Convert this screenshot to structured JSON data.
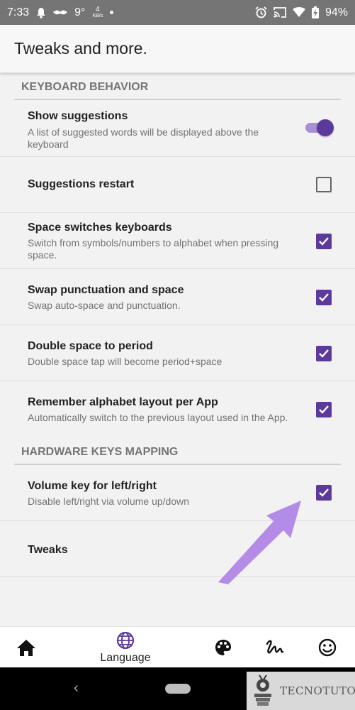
{
  "status_bar": {
    "time": "7:33",
    "temperature": "9°",
    "speed_value": "4",
    "speed_unit": "KB/s",
    "battery": "94%",
    "icons": [
      "bell-icon",
      "mustache-icon",
      "alarm-icon",
      "cast-icon",
      "wifi-icon",
      "battery-charging-icon"
    ]
  },
  "app_bar": {
    "title": "Tweaks and more."
  },
  "sections": [
    {
      "header": "KEYBOARD BEHAVIOR"
    },
    {
      "header": "HARDWARE KEYS MAPPING"
    }
  ],
  "settings": [
    {
      "title": "Show suggestions",
      "summary": "A list of suggested words will be displayed above the keyboard",
      "control": "toggle",
      "checked": true
    },
    {
      "title": "Suggestions restart",
      "summary": "",
      "control": "checkbox",
      "checked": false
    },
    {
      "title": "Space switches keyboards",
      "summary": "Switch from symbols/numbers to alphabet when pressing space.",
      "control": "checkbox",
      "checked": true
    },
    {
      "title": "Swap punctuation and space",
      "summary": "Swap auto-space and punctuation.",
      "control": "checkbox",
      "checked": true
    },
    {
      "title": "Double space to period",
      "summary": "Double space tap will become period+space",
      "control": "checkbox",
      "checked": true
    },
    {
      "title": "Remember alphabet layout per App",
      "summary": "Automatically switch to the previous layout used in the App.",
      "control": "checkbox",
      "checked": true
    },
    {
      "title": "Volume key for left/right",
      "summary": "Disable left/right via volume up/down",
      "control": "checkbox",
      "checked": true
    },
    {
      "title": "Tweaks",
      "summary": ""
    }
  ],
  "bottom_nav": {
    "items": [
      {
        "icon": "home-icon",
        "label": ""
      },
      {
        "icon": "globe-icon",
        "label": "Language"
      },
      {
        "icon": "palette-icon",
        "label": ""
      },
      {
        "icon": "gesture-icon",
        "label": ""
      },
      {
        "icon": "smiley-icon",
        "label": ""
      }
    ]
  },
  "watermark": {
    "text": "TECNOTUTO"
  },
  "colors": {
    "accent": "#5b3a9b",
    "accent_light": "#a990d6",
    "arrow": "#b48ce8",
    "status_bar": "#757575"
  }
}
